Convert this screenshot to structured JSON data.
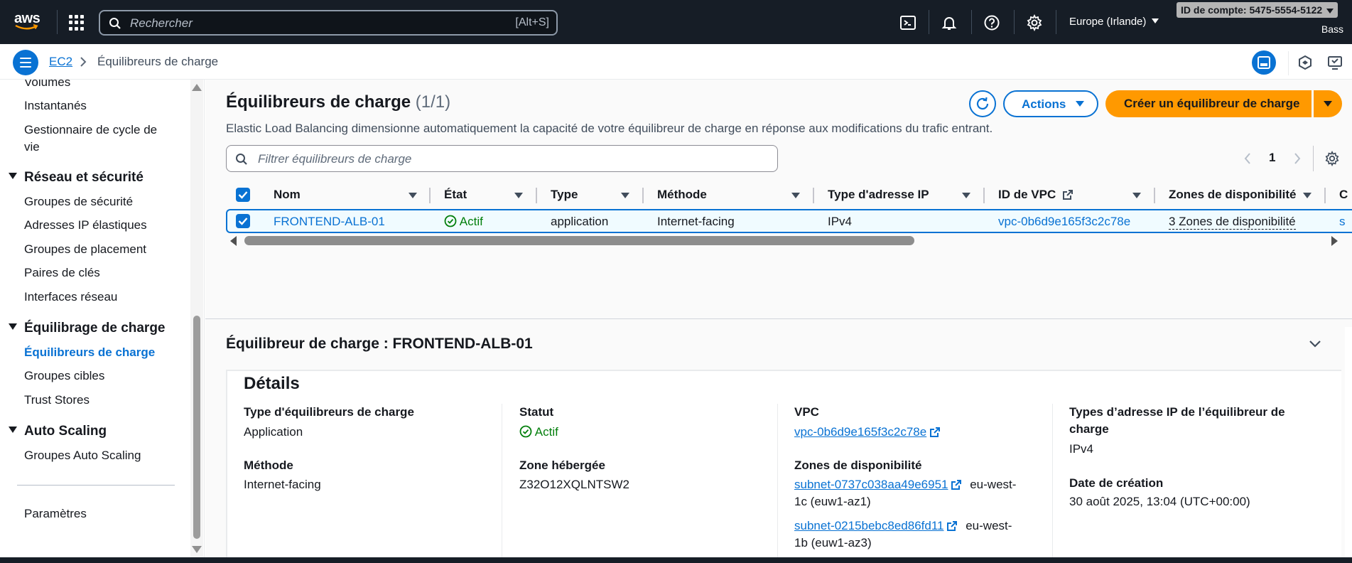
{
  "topnav": {
    "logo": "aws",
    "search_placeholder": "Rechercher",
    "search_shortcut": "[Alt+S]",
    "region": "Europe (Irlande)",
    "account": "ID de compte: 5475-5554-5122",
    "user": "Bass"
  },
  "breadcrumb": {
    "parent": "EC2",
    "current": "Équilibreurs de charge"
  },
  "sidebar": {
    "items_top": [
      "Volumes",
      "Instantanés",
      "Gestionnaire de cycle de",
      "vie"
    ],
    "section_network": "Réseau et sécurité",
    "network_items": [
      "Groupes de sécurité",
      "Adresses IP élastiques",
      "Groupes de placement",
      "Paires de clés",
      "Interfaces réseau"
    ],
    "section_lb": "Équilibrage de charge",
    "lb_items": [
      "Équilibreurs de charge",
      "Groupes cibles",
      "Trust Stores"
    ],
    "section_as": "Auto Scaling",
    "as_items": [
      "Groupes Auto Scaling"
    ],
    "settings": "Paramètres"
  },
  "main": {
    "title": "Équilibreurs de charge",
    "count": "(1/1)",
    "description": "Elastic Load Balancing dimensionne automatiquement la capacité de votre équilibreur de charge en réponse aux modifications du trafic entrant.",
    "actions_label": "Actions",
    "create_label": "Créer un équilibreur de charge",
    "filter_placeholder": "Filtrer équilibreurs de charge",
    "page_number": "1"
  },
  "table": {
    "columns": [
      "Nom",
      "État",
      "Type",
      "Méthode",
      "Type d'adresse IP",
      "ID de VPC",
      "Zones de disponibilité",
      "C"
    ],
    "rows": [
      {
        "name": "FRONTEND-ALB-01",
        "state": "Actif",
        "type": "application",
        "scheme": "Internet-facing",
        "ip_type": "IPv4",
        "vpc": "vpc-0b6d9e165f3c2c78e",
        "zones": "3 Zones de disponibilité",
        "extra": "s"
      }
    ]
  },
  "details": {
    "panel_title": "Équilibreur de charge : FRONTEND-ALB-01",
    "card_title": "Détails",
    "lb_type_label": "Type d'équilibreurs de charge",
    "lb_type_value": "Application",
    "scheme_label": "Méthode",
    "scheme_value": "Internet-facing",
    "status_label": "Statut",
    "status_value": "Actif",
    "hosted_zone_label": "Zone hébergée",
    "hosted_zone_value": "Z32O12XQLNTSW2",
    "vpc_label": "VPC",
    "vpc_value": "vpc-0b6d9e165f3c2c78e",
    "az_label": "Zones de disponibilité",
    "az_1_subnet": "subnet-0737c038aa49e6951",
    "az_1_zone_a": "eu-west-",
    "az_1_zone_b": "1c (euw1-az1)",
    "az_2_subnet": "subnet-0215bebc8ed86fd11",
    "az_2_zone_a": "eu-west-",
    "az_2_zone_b": "1b (euw1-az3)",
    "ip_types_label_a": "Types d’adresse IP de l’équilibreur de",
    "ip_types_label_b": "charge",
    "ip_types_value": "IPv4",
    "created_label": "Date de création",
    "created_value": "30 août 2025, 13:04 (UTC+00:00)"
  },
  "colors": {
    "nav_bg": "#161d26",
    "link": "#0972d3",
    "primary_button": "#ff9900",
    "success": "#037f0c"
  }
}
